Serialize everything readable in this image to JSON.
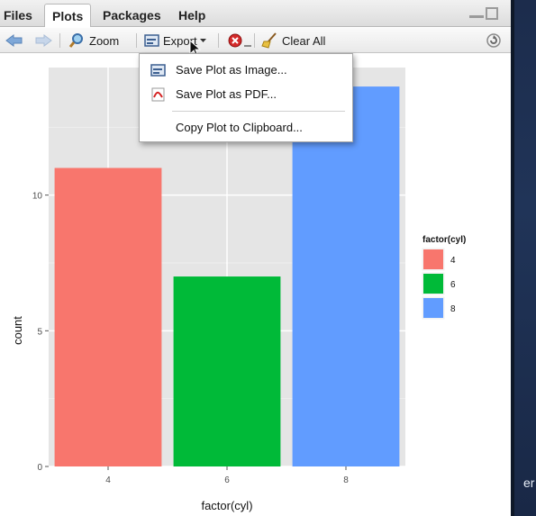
{
  "tabs": [
    {
      "label": "Files",
      "active": false
    },
    {
      "label": "Plots",
      "active": true
    },
    {
      "label": "Packages",
      "active": false
    },
    {
      "label": "Help",
      "active": false
    }
  ],
  "toolbar": {
    "back_icon": "arrow-left-icon",
    "forward_icon": "arrow-right-icon",
    "zoom_label": "Zoom",
    "export_label": "Export",
    "remove_icon": "remove-plot-icon",
    "clear_label": "Clear All",
    "refresh_icon": "refresh-icon"
  },
  "export_menu": {
    "items": [
      {
        "label": "Save Plot as Image...",
        "icon": "image-icon"
      },
      {
        "label": "Save Plot as PDF...",
        "icon": "pdf-icon"
      },
      {
        "label": "Copy Plot to Clipboard...",
        "icon": ""
      }
    ]
  },
  "colors": {
    "bar_4": "#f8766d",
    "bar_6": "#00ba38",
    "bar_8": "#619cff",
    "panel_bg": "#e5e5e5"
  },
  "chart_data": {
    "type": "bar",
    "categories": [
      "4",
      "6",
      "8"
    ],
    "values": [
      11,
      7,
      14
    ],
    "title": "",
    "xlabel": "factor(cyl)",
    "ylabel": "count",
    "ylim": [
      0,
      14.7
    ],
    "yticks": [
      "0",
      "5",
      "10"
    ],
    "grid": true,
    "legend": {
      "title": "factor(cyl)",
      "position": "right",
      "entries": [
        "4",
        "6",
        "8"
      ]
    }
  },
  "desktop_text": "er"
}
